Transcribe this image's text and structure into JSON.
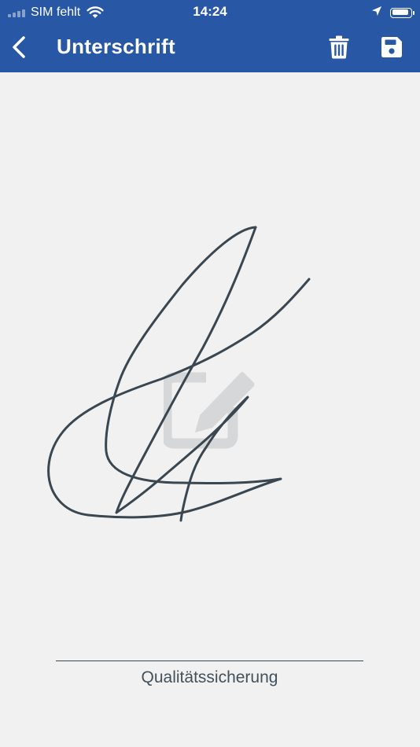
{
  "status_bar": {
    "carrier": "SIM fehlt",
    "time": "14:24",
    "battery_level": 0.9
  },
  "nav": {
    "title": "Unterschrift"
  },
  "signer": {
    "name": "Qualitätssicherung"
  },
  "icons": {
    "back": "chevron-left-icon",
    "delete": "trash-icon",
    "save": "floppy-disk-icon",
    "placeholder": "edit-square-icon",
    "location": "location-arrow-icon",
    "wifi": "wifi-icon"
  },
  "colors": {
    "header": "#2757a5",
    "canvas": "#f1f1f1",
    "ink": "#3a4650",
    "placeholder": "#d6d7d9"
  }
}
